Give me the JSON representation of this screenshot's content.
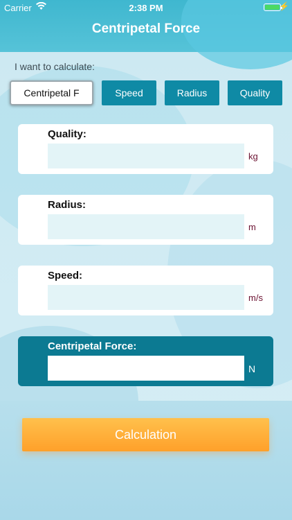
{
  "status_bar": {
    "carrier": "Carrier",
    "time": "2:38 PM"
  },
  "nav": {
    "title": "Centripetal Force"
  },
  "prompt": "I want to calculate:",
  "segments": [
    {
      "label": "Centripetal F",
      "active": true
    },
    {
      "label": "Speed",
      "active": false
    },
    {
      "label": "Radius",
      "active": false
    },
    {
      "label": "Quality",
      "active": false
    }
  ],
  "fields": [
    {
      "label": "Quality:",
      "value": "",
      "unit": "kg"
    },
    {
      "label": "Radius:",
      "value": "",
      "unit": "m"
    },
    {
      "label": "Speed:",
      "value": "",
      "unit": "m/s"
    },
    {
      "label": "Centripetal Force:",
      "value": "",
      "unit": "N"
    }
  ],
  "calculate_button": "Calculation",
  "colors": {
    "accent": "#0f8aa5",
    "result_card": "#0c7a92",
    "button_orange": "#ffa02a",
    "unit_text": "#6b1131"
  }
}
